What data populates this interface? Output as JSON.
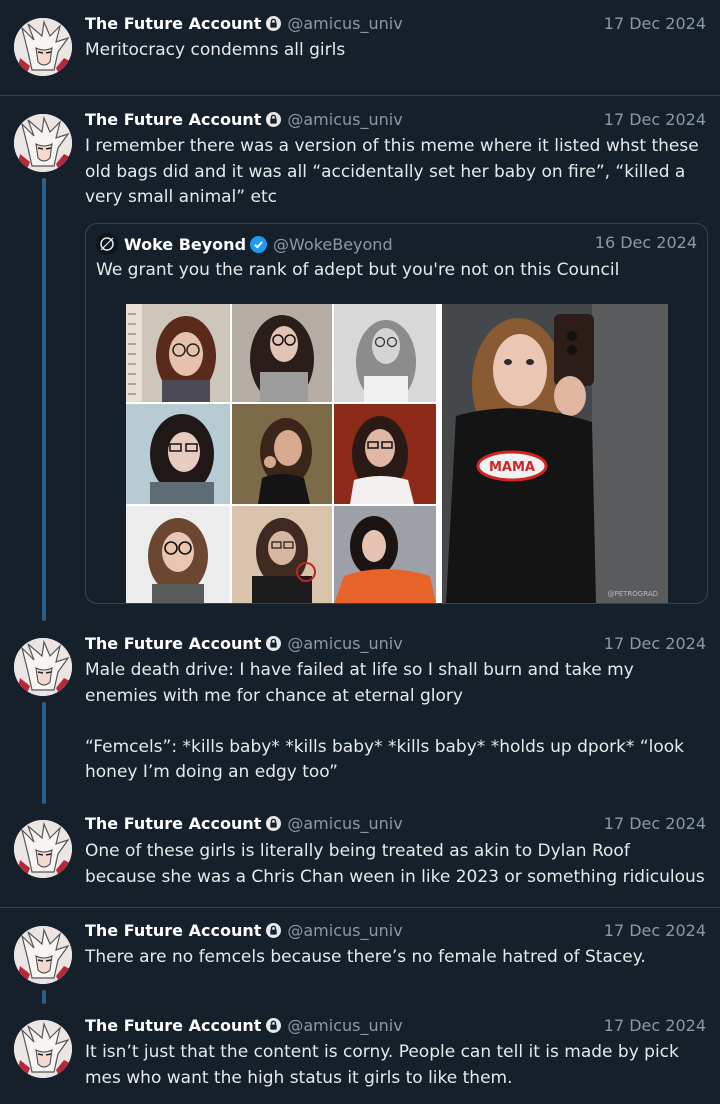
{
  "account": {
    "name": "The Future Account",
    "handle": "@amicus_univ"
  },
  "tweets": [
    {
      "date": "17 Dec 2024",
      "text": "Meritocracy condemns all girls"
    },
    {
      "date": "17 Dec 2024",
      "text": "I remember there was a version of this meme where it listed whst these old bags did and it was all “accidentally set her baby on fire”, “killed a very small animal” etc"
    },
    {
      "date": "17 Dec 2024",
      "text": "Male death drive: I have failed at life so I shall burn and take my enemies with me for chance at eternal glory\n\n“Femcels”: *kills baby* *kills baby* *kills baby* *holds up dpork* “look honey I’m doing an edgy too”"
    },
    {
      "date": "17 Dec 2024",
      "text": "One of these girls is literally being treated as akin to Dylan Roof because she was a Chris Chan ween in like 2023 or something ridiculous"
    },
    {
      "date": "17 Dec 2024",
      "text": "There are no femcels because there’s no female hatred of Stacey."
    },
    {
      "date": "17 Dec 2024",
      "text": "It isn’t just that the content is corny. People can tell it is made by pick mes who want the high status it girls to like them."
    }
  ],
  "quote": {
    "name": "Woke Beyond",
    "handle": "@WokeBeyond",
    "date": "16 Dec 2024",
    "text": "We grant you the rank of adept but you're not on this Council",
    "image_watermark": "@PETROGRAD",
    "shirt_text": "MAMA"
  },
  "colors": {
    "background": "#15202b",
    "divider": "#38444d",
    "thread_line": "#2b5f8a",
    "muted_text": "#8b98a5",
    "verified": "#1d9bf0"
  },
  "icons": [
    "lock-icon",
    "verified-badge-icon",
    "avatar"
  ]
}
